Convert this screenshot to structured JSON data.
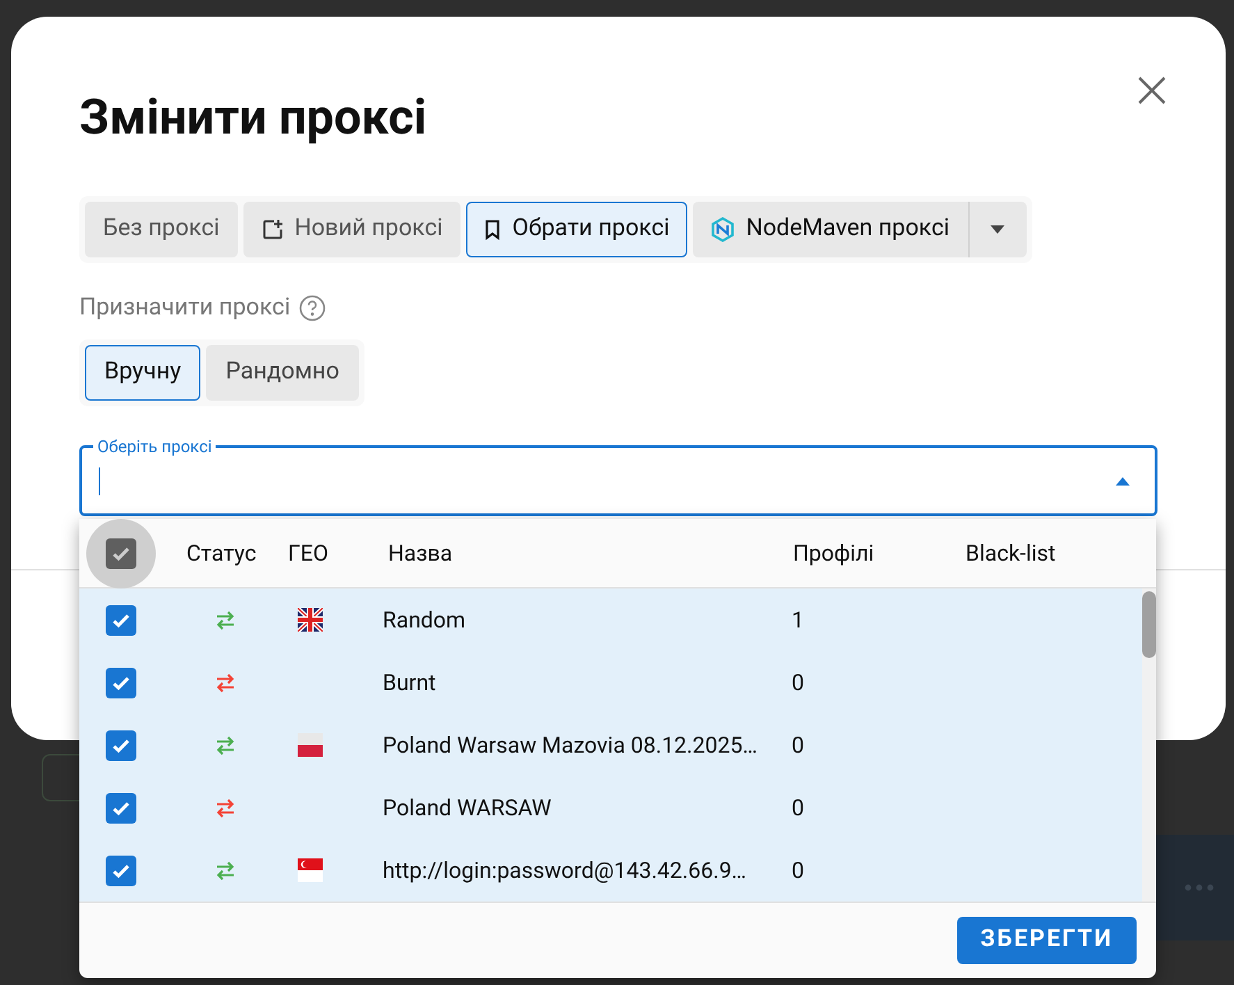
{
  "dialog": {
    "title": "Змінити проксі",
    "proxy_tabs": [
      {
        "label": "Без проксі",
        "kind": "plain",
        "selected": false
      },
      {
        "label": "Новий проксі",
        "kind": "new",
        "selected": false
      },
      {
        "label": "Обрати проксі",
        "kind": "saved",
        "selected": true
      },
      {
        "label": "NodeMaven проксі",
        "kind": "provider",
        "selected": false
      }
    ],
    "assign_label": "Призначити проксі",
    "assign_modes": [
      {
        "label": "Вручну",
        "selected": true
      },
      {
        "label": "Рандомно",
        "selected": false
      }
    ],
    "select_field": {
      "label": "Оберіть проксі",
      "focused": true
    }
  },
  "dropdown": {
    "select_all_checked": true,
    "columns": [
      "Статус",
      "ГЕО",
      "Назва",
      "Профілі",
      "Black-list"
    ],
    "rows": [
      {
        "checked": true,
        "selected": true,
        "color": "#4caf50",
        "name": "Random",
        "profiles": "1"
      },
      {
        "checked": true,
        "selected": true,
        "color": "#f44336",
        "name": "Burnt",
        "profiles": "0"
      },
      {
        "checked": true,
        "selected": true,
        "color": "#4caf50",
        "name": "Poland Warsaw Mazovia 08.12.2025…",
        "profiles": "0"
      },
      {
        "checked": true,
        "selected": true,
        "color": "#f44336",
        "name": "Poland WARSAW",
        "profiles": "0"
      },
      {
        "checked": true,
        "selected": true,
        "color": "#4caf50",
        "name": "http://login:password@143.42.66.9…",
        "profiles": "0"
      }
    ],
    "save_button": "ЗБЕРЕГТИ"
  }
}
